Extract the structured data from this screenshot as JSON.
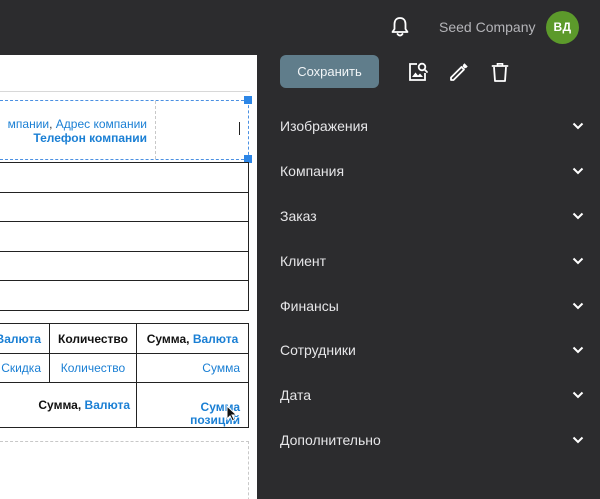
{
  "header": {
    "company_name": "Seed Company",
    "avatar_initials": "ВД",
    "notification_icon": "bell-icon"
  },
  "document": {
    "header_cell": {
      "address_prefix": "мпании",
      "address_separator": ",",
      "address_label": "Адрес компании",
      "phone_label": "Телефон компании"
    },
    "items_table": {
      "header_row": {
        "col1_label": "Валюта",
        "col2_label": "Количество",
        "col3_label_prefix": "Сумма,",
        "col3_label_value": "Валюта"
      },
      "data_row": {
        "col1_value": "Скидка",
        "col2_value": "Количество",
        "col3_value": "Сумма"
      },
      "total_row": {
        "label_prefix": "Сумма,",
        "label_value": "Валюта",
        "value_line1": "Сумма",
        "value_line2": "позиций"
      }
    }
  },
  "toolbar": {
    "save_label": "Сохранить",
    "icons": [
      "image-search-icon",
      "edit-pencil-icon",
      "trash-icon"
    ]
  },
  "sections": [
    {
      "label": "Изображения"
    },
    {
      "label": "Компания"
    },
    {
      "label": "Заказ"
    },
    {
      "label": "Клиент"
    },
    {
      "label": "Финансы"
    },
    {
      "label": "Сотрудники"
    },
    {
      "label": "Дата"
    },
    {
      "label": "Дополнительно"
    }
  ],
  "colors": {
    "panel_bg": "#2c2c2e",
    "accent_blue": "#1a7fd4",
    "save_button": "#607d8b",
    "avatar_green": "#5c9a2b",
    "selection_handle": "#2d86e6"
  }
}
